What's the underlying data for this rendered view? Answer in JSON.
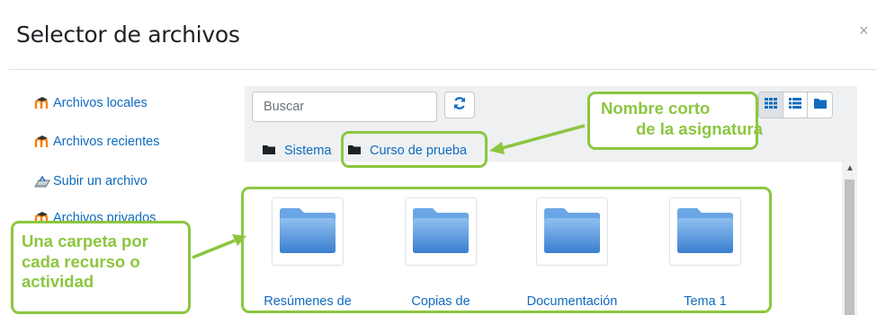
{
  "dialog": {
    "title": "Selector de archivos",
    "close_symbol": "×"
  },
  "sidebar": {
    "items": [
      {
        "label": "Archivos locales",
        "icon": "moodle-icon"
      },
      {
        "label": "Archivos recientes",
        "icon": "moodle-icon"
      },
      {
        "label": "Subir un archivo",
        "icon": "upload-icon"
      },
      {
        "label": "Archivos privados",
        "icon": "moodle-icon"
      }
    ]
  },
  "toolbar": {
    "search_placeholder": "Buscar",
    "refresh_icon": "refresh-icon",
    "view_modes": [
      {
        "name": "icons-view",
        "active": true
      },
      {
        "name": "list-view",
        "active": false
      },
      {
        "name": "tree-view",
        "active": false
      }
    ]
  },
  "breadcrumb": {
    "items": [
      {
        "label": "Sistema",
        "icon": "folder-icon"
      },
      {
        "label": "Curso de prueba",
        "icon": "folder-icon"
      }
    ]
  },
  "files": [
    {
      "name": "Resúmenes de"
    },
    {
      "name": "Copias de"
    },
    {
      "name": "Documentación"
    },
    {
      "name": "Tema 1"
    }
  ],
  "annotations": {
    "course_short_name": "Nombre corto de la asignatura",
    "course_short_name_lines": [
      "Nombre corto",
      "de la asignatura"
    ],
    "folder_per_resource_lines": [
      "Una carpeta por",
      "cada recurso o",
      "actividad"
    ]
  },
  "colors": {
    "accent_link": "#0f6cbf",
    "annotation_green": "#8cc63f",
    "moodle_orange": "#f98012",
    "folder_blue": "#4a8fd8"
  }
}
